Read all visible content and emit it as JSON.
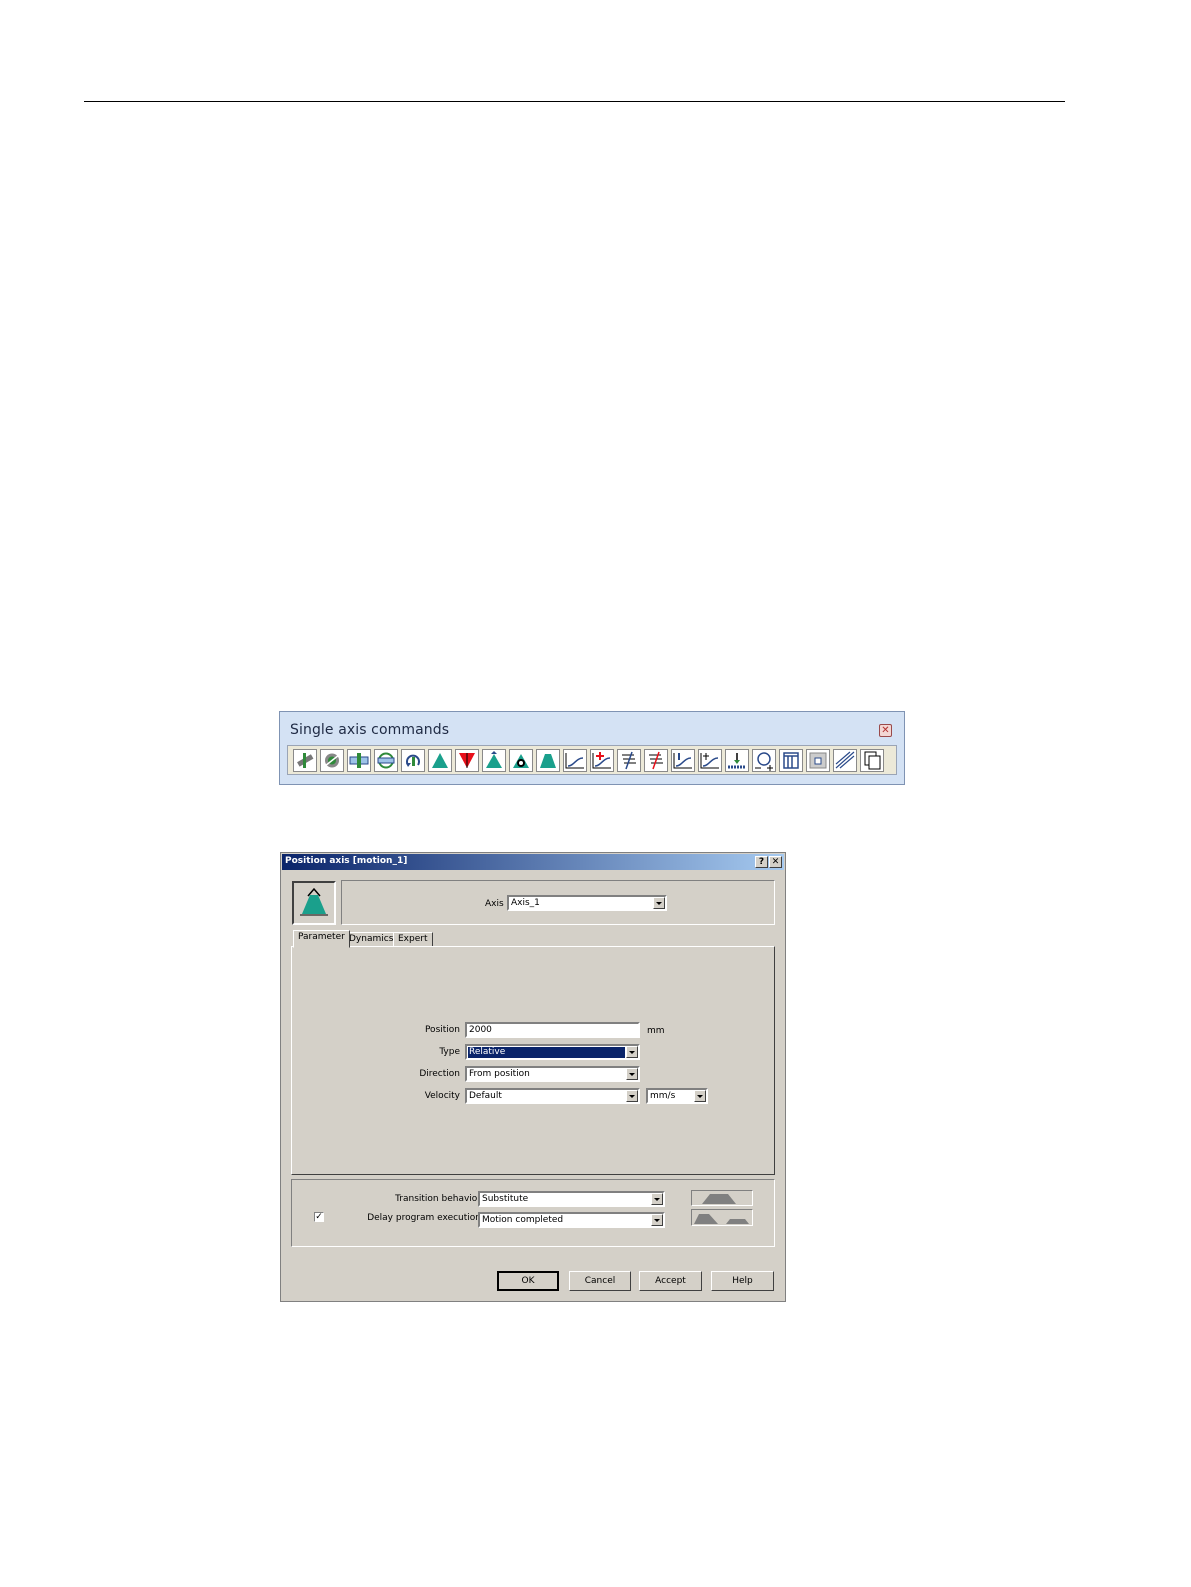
{
  "toolbar": {
    "title": "Single axis commands",
    "close_icon": "close-icon",
    "buttons": [
      "enable-axis-icon",
      "disable-axis-icon",
      "switch-on-icon",
      "switch-off-icon",
      "homing-icon",
      "position-axis-icon",
      "stop-axis-icon",
      "move-axis-icon",
      "relative-move-icon",
      "absolute-move-icon",
      "gear-sync-icon",
      "gear-offset-icon",
      "cam-icon",
      "cam-offset-icon",
      "measure-icon",
      "measure-offset-icon",
      "superimpose-icon",
      "torque-icon",
      "output-cam-icon",
      "cam-track-icon",
      "curve-icon",
      "copy-icon"
    ]
  },
  "dialog": {
    "title": "Position axis [motion_1]",
    "help_btn": "?",
    "close_btn": "✕",
    "axis_label": "Axis",
    "axis_value": "Axis_1",
    "tabs": [
      "Parameter",
      "Dynamics",
      "Expert"
    ],
    "position_label": "Position",
    "position_value": "2000",
    "position_unit": "mm",
    "type_label": "Type",
    "type_value": "Relative",
    "direction_label": "Direction",
    "direction_value": "From position",
    "velocity_label": "Velocity",
    "velocity_value": "Default",
    "velocity_unit": "mm/s",
    "transition_label": "Transition behavior",
    "transition_value": "Substitute",
    "delay_label": "Delay program execution",
    "delay_checked": "✓",
    "delay_value": "Motion completed",
    "buttons": {
      "ok": "OK",
      "cancel": "Cancel",
      "accept": "Accept",
      "help": "Help"
    }
  },
  "colors": {
    "teal": "#1aa08c",
    "red": "#e8101a",
    "titlebar": "#0a246a"
  }
}
